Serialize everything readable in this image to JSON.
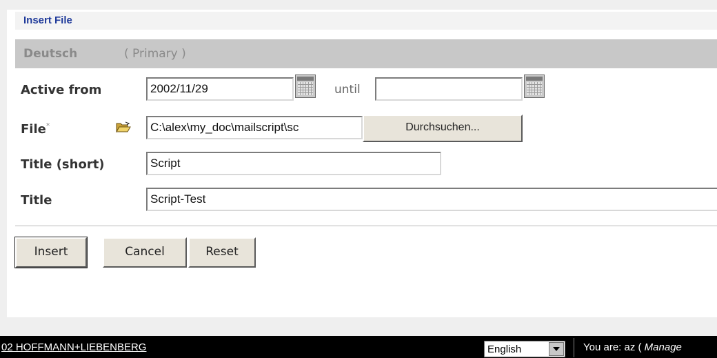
{
  "header": {
    "title": "Insert File"
  },
  "language": {
    "name": "Deutsch",
    "primary_label": "( Primary )"
  },
  "form": {
    "active_from": {
      "label": "Active from",
      "value": "2002/11/29",
      "until_label": "until",
      "until_value": ""
    },
    "file": {
      "label": "File",
      "required_mark": "*",
      "value": "C:\\alex\\my_doc\\mailscript\\sc",
      "browse_label": "Durchsuchen..."
    },
    "title_short": {
      "label": "Title (short)",
      "value": "Script"
    },
    "title": {
      "label": "Title",
      "value": "Script-Test"
    }
  },
  "actions": {
    "insert": "Insert",
    "cancel": "Cancel",
    "reset": "Reset"
  },
  "footer": {
    "copyright": "02 HOFFMANN+LIEBENBERG",
    "language_select": "English",
    "user_prefix": "You are: az (",
    "user_role": "Manage"
  }
}
